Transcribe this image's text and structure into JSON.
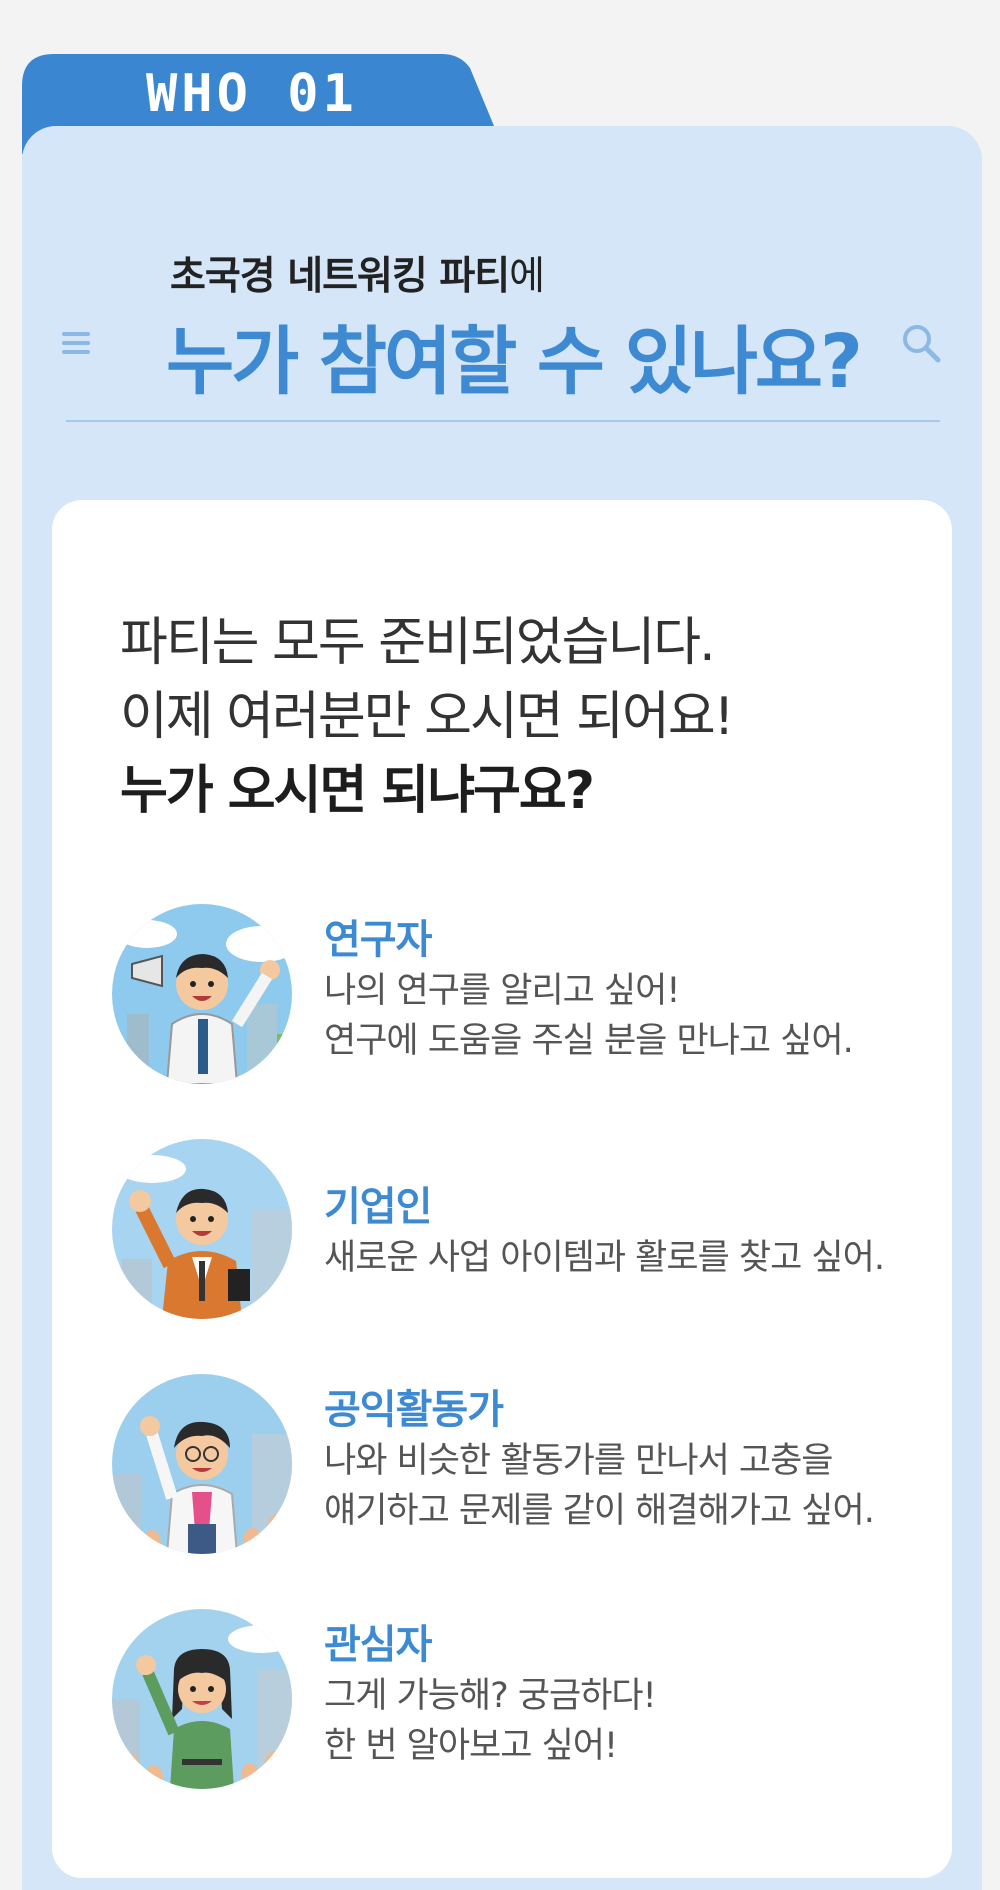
{
  "tab": {
    "label": "WHO 01"
  },
  "header": {
    "subtitle_bold": "초국경 네트워킹 파티",
    "subtitle_tail": "에",
    "title": "누가 참여할 수 있나요?"
  },
  "intro": {
    "line1": "파티는 모두 준비되었습니다.",
    "line2": "이제 여러분만 오시면 되어요!",
    "line3": "누가 오시면 되냐구요?"
  },
  "people": [
    {
      "role": "연구자",
      "desc1": "나의 연구를 알리고 싶어!",
      "desc2": "연구에 도움을 주실 분을 만나고 싶어."
    },
    {
      "role": "기업인",
      "desc1": "새로운 사업 아이템과 활로를 찾고 싶어.",
      "desc2": ""
    },
    {
      "role": "공익활동가",
      "desc1": "나와 비슷한 활동가를 만나서 고충을",
      "desc2": "얘기하고 문제를 같이 해결해가고 싶어."
    },
    {
      "role": "관심자",
      "desc1": "그게 가능해? 궁금하다!",
      "desc2": "한 번 알아보고 싶어!"
    }
  ],
  "icons": {
    "menu": "menu-icon",
    "search": "search-icon"
  },
  "colors": {
    "accent": "#3d8ad3",
    "tab": "#3a86d0",
    "panel": "#d4e6f7",
    "card": "#ffffff"
  }
}
